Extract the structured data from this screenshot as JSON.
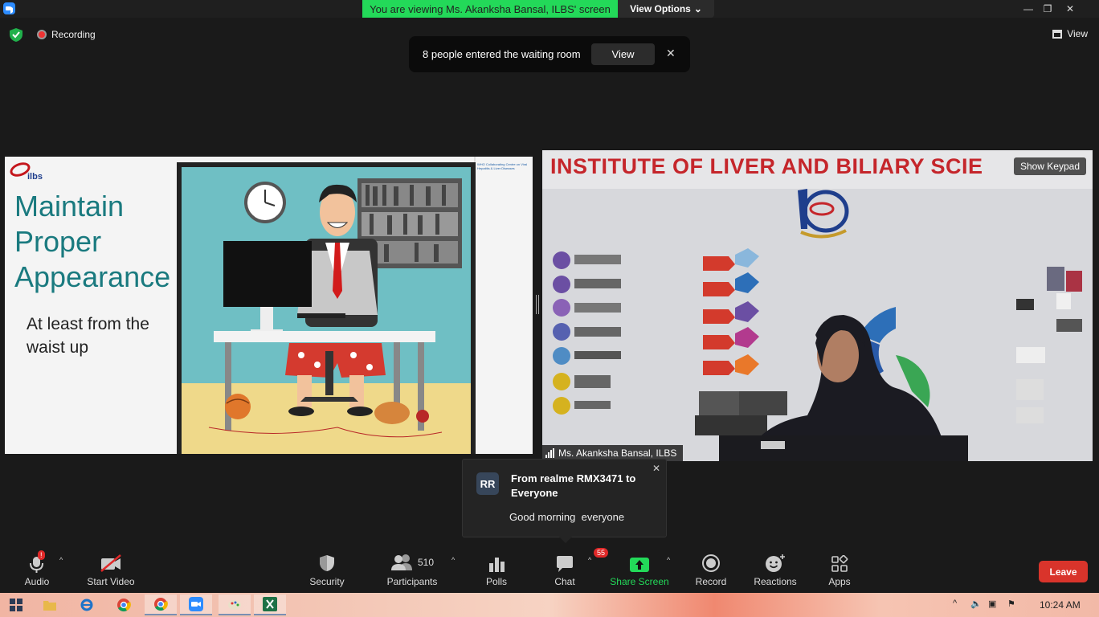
{
  "titlebar": {
    "viewing_text": "You are viewing Ms. Akanksha Bansal, ILBS' screen",
    "view_options": "View Options",
    "minimize": "—",
    "restore": "❐",
    "close": "✕"
  },
  "topbar": {
    "recording": "Recording",
    "view": "View"
  },
  "waiting_room": {
    "text": "8 people entered the waiting room",
    "view_button": "View",
    "close": "✕"
  },
  "slide": {
    "logo_text": "ilbs",
    "title": "Maintain Proper Appearance",
    "subtitle": "At least from the waist up",
    "corner_note": "WHO Collaborating Centre on Viral Hepatitis & Liver Diseases"
  },
  "video": {
    "banner_title": "INSTITUTE OF LIVER AND BILIARY SCIE",
    "show_keypad": "Show Keypad",
    "participant_name": "Ms. Akanksha Bansal, ILBS"
  },
  "chat_popup": {
    "avatar": "RR",
    "from": "From realme RMX3471 to Everyone",
    "message": "Good morning  everyone",
    "close": "✕"
  },
  "toolbar": {
    "audio": "Audio",
    "audio_alert": "!",
    "start_video": "Start Video",
    "security": "Security",
    "participants": "Participants",
    "participants_count": "510",
    "polls": "Polls",
    "chat": "Chat",
    "chat_badge": "55",
    "share_screen": "Share Screen",
    "record": "Record",
    "reactions": "Reactions",
    "apps": "Apps",
    "leave": "Leave"
  },
  "taskbar": {
    "clock": "10:24 AM"
  },
  "colors": {
    "share_green": "#23d959",
    "leave_red": "#d9342b",
    "slide_teal": "#1a7a7f",
    "banner_red": "#c5262b"
  }
}
